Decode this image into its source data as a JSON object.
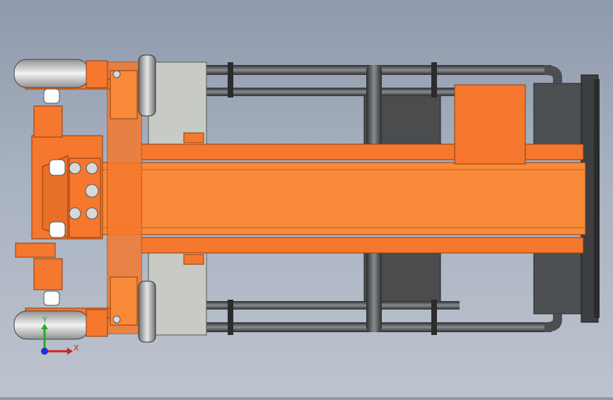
{
  "viewport": {
    "background_top": "#8e99ab",
    "background_bottom": "#bcc3ce"
  },
  "model": {
    "orange": "#f5782e",
    "orange_dark": "#b8521a",
    "steel": "#4a4d4f",
    "steel_light": "#7b7f82",
    "plate_grey": "#c9cbc6",
    "wheel_grey": "#d8d8d8"
  },
  "triad": {
    "x_label": "X",
    "y_label": "Y",
    "x_color": "#d42020",
    "y_color": "#20b020",
    "origin_color": "#2030d0"
  }
}
